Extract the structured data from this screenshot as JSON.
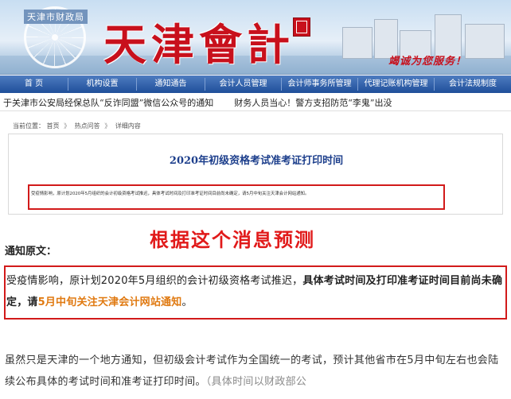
{
  "banner": {
    "dept": "天津市财政局",
    "title": "天津會計",
    "slogan": "竭诚为您服务！"
  },
  "nav": {
    "items": [
      {
        "label": "首    页"
      },
      {
        "label": "机构设置"
      },
      {
        "label": "通知通告"
      },
      {
        "label": "会计人员管理"
      },
      {
        "label": "会计师事务所管理"
      },
      {
        "label": "代理记账机构管理"
      },
      {
        "label": "会计法规制度"
      }
    ]
  },
  "ticker": {
    "item1": "于关津市公安局经保总队“反诈同盟”微信公众号的通知",
    "item2": "财务人员当心！警方支招防范“李鬼”出没"
  },
  "breadcrumb": {
    "label": "当前位置：",
    "items": [
      "首页",
      "热点问答",
      "详细内容"
    ],
    "sep": "》"
  },
  "article": {
    "title": "2020年初级资格考试准考证打印时间",
    "line": "受疫情影响，原计划2020年5月组织的会计初级资格考试推迟，具体考试时间及打印准考证时间目前尚未确定，请5月中旬关注天津会计网站通知。"
  },
  "annotation": "根据这个消息预测",
  "notice": {
    "heading": "通知原文：",
    "part1": "受疫情影响，原计划2020年5月组织的会计初级资格考试推迟，",
    "part2": "具体考试时间及打印准考证时间目前尚未确定，请",
    "part3": "5月中旬关注天津会计网站通知",
    "part4": "。"
  },
  "paragraph": {
    "text": "虽然只是天津的一个地方通知，但初级会计考试作为全国统一的考试，预计其他省市在5月中旬左右也会陆续公布具体的考试时间和准考证打印时间。",
    "gray": "（具体时间以财政部公"
  },
  "colors": {
    "accent_red": "#d21a1a",
    "nav_blue": "#1f4f9a",
    "title_blue": "#1d3f8c",
    "highlight_orange": "#e07a12"
  }
}
